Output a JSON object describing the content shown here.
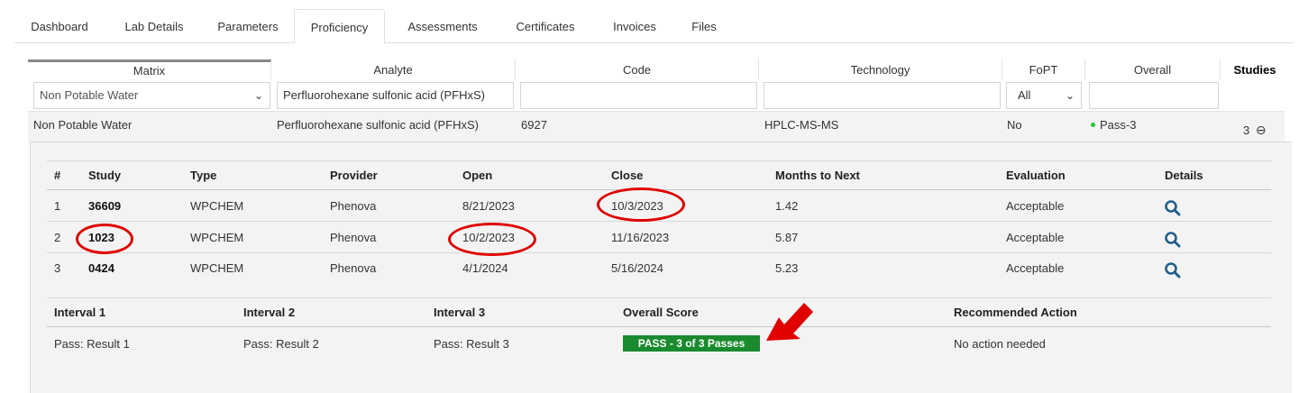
{
  "tabs": [
    {
      "label": "Dashboard"
    },
    {
      "label": "Lab Details"
    },
    {
      "label": "Parameters"
    },
    {
      "label": "Proficiency",
      "active": true
    },
    {
      "label": "Assessments"
    },
    {
      "label": "Certificates"
    },
    {
      "label": "Invoices"
    },
    {
      "label": "Files"
    }
  ],
  "grid": {
    "columns": [
      "Matrix",
      "Analyte",
      "Code",
      "Technology",
      "FoPT",
      "Overall",
      "Studies"
    ],
    "filters": {
      "matrix": "Non Potable Water",
      "analyte": "Perfluorohexane sulfonic acid (PFHxS)",
      "code": "",
      "technology": "",
      "fopt": "All",
      "overall": ""
    },
    "row": {
      "matrix": "Non Potable Water",
      "analyte": "Perfluorohexane sulfonic acid (PFHxS)",
      "code": "6927",
      "technology": "HPLC-MS-MS",
      "fopt": "No",
      "overall": "Pass-3",
      "studies": "3",
      "collapse_symbol": "⊖",
      "status_color": "#22cc33"
    }
  },
  "detail": {
    "columns": [
      "#",
      "Study",
      "Type",
      "Provider",
      "Open",
      "Close",
      "Months to Next",
      "Evaluation",
      "Details"
    ],
    "rows": [
      {
        "num": "1",
        "study": "36609",
        "type": "WPCHEM",
        "provider": "Phenova",
        "open": "8/21/2023",
        "close": "10/3/2023",
        "months": "1.42",
        "evaluation": "Acceptable"
      },
      {
        "num": "2",
        "study": "1023",
        "type": "WPCHEM",
        "provider": "Phenova",
        "open": "10/2/2023",
        "close": "11/16/2023",
        "months": "5.87",
        "evaluation": "Acceptable"
      },
      {
        "num": "3",
        "study": "0424",
        "type": "WPCHEM",
        "provider": "Phenova",
        "open": "4/1/2024",
        "close": "5/16/2024",
        "months": "5.23",
        "evaluation": "Acceptable"
      }
    ],
    "details_icon": "magnifier-icon",
    "summary": {
      "headers": [
        "Interval 1",
        "Interval 2",
        "Interval 3",
        "Overall Score",
        "Recommended Action"
      ],
      "interval1": "Pass: Result 1",
      "interval2": "Pass: Result 2",
      "interval3": "Pass: Result 3",
      "overall_score": "PASS - 3 of 3 Passes",
      "recommended_action": "No action needed"
    }
  },
  "colors": {
    "pass_badge": "#1a8a2e",
    "annotation": "#e00000",
    "icon": "#1f5f8b"
  }
}
